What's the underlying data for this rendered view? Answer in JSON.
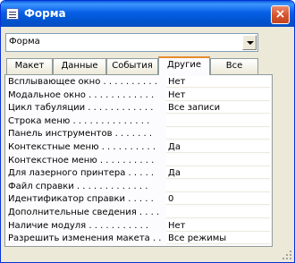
{
  "window": {
    "title": "Форма",
    "close_label": "×"
  },
  "combo": {
    "value": "Форма"
  },
  "tabs": [
    {
      "label": "Макет"
    },
    {
      "label": "Данные"
    },
    {
      "label": "События"
    },
    {
      "label": "Другие"
    },
    {
      "label": "Все"
    }
  ],
  "active_tab": "Другие",
  "properties": [
    {
      "label": "Всплывающее окно . . . . . . . . . .",
      "value": "Нет"
    },
    {
      "label": "Модальное окно . . . . . . . . . . . .",
      "value": "Нет"
    },
    {
      "label": "Цикл табуляции . . . . . . . . . . . .",
      "value": "Все записи"
    },
    {
      "label": "Строка меню . . . . . . . . . . . . . .",
      "value": ""
    },
    {
      "label": "Панель инструментов . . . . . . .",
      "value": ""
    },
    {
      "label": "Контекстные меню . . . . . . . . . .",
      "value": "Да"
    },
    {
      "label": "Контекстное меню . . . . . . . . . .",
      "value": ""
    },
    {
      "label": "Для лазерного принтера . . . . .",
      "value": "Да"
    },
    {
      "label": "Файл справки . . . . . . . . . . . . .",
      "value": ""
    },
    {
      "label": "Идентификатор справки . . . . .",
      "value": "0"
    },
    {
      "label": "Дополнительные сведения . . . .",
      "value": ""
    },
    {
      "label": "Наличие модуля . . . . . . . . . . .",
      "value": "Нет"
    },
    {
      "label": "Разрешить изменения макета . .",
      "value": "Все режимы"
    }
  ]
}
